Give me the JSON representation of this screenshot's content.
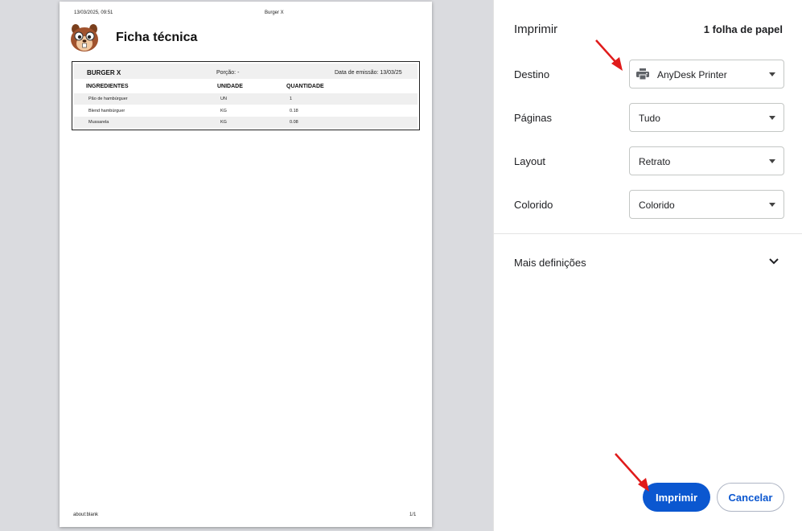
{
  "preview": {
    "header_datetime": "13/03/2025, 09:51",
    "header_title": "Burger X",
    "doc_title": "Ficha técnica",
    "footer_url": "about:blank",
    "footer_page": "1/1",
    "sheet": {
      "name": "BURGER X",
      "porcao": "Porção: -",
      "data_emissao": "Data de emissão: 13/03/25",
      "columns": [
        "INGREDIENTES",
        "UNIDADE",
        "QUANTIDADE"
      ],
      "rows": [
        [
          "Pão de hambúrguer",
          "UN",
          "1"
        ],
        [
          "Blend hambúrguer",
          "KG",
          "0.18"
        ],
        [
          "Mussarela",
          "KG",
          "0.08"
        ]
      ]
    }
  },
  "panel": {
    "title": "Imprimir",
    "sheet_count": "1 folha de papel",
    "fields": [
      {
        "label": "Destino",
        "value": "AnyDesk Printer",
        "icon": "printer-icon"
      },
      {
        "label": "Páginas",
        "value": "Tudo"
      },
      {
        "label": "Layout",
        "value": "Retrato"
      },
      {
        "label": "Colorido",
        "value": "Colorido"
      }
    ],
    "more_settings": "Mais definições",
    "print_button": "Imprimir",
    "cancel_button": "Cancelar"
  },
  "colors": {
    "accent": "#0b57d0",
    "annotation_arrow": "#e01b1b",
    "preview_background": "#dadbdf"
  }
}
